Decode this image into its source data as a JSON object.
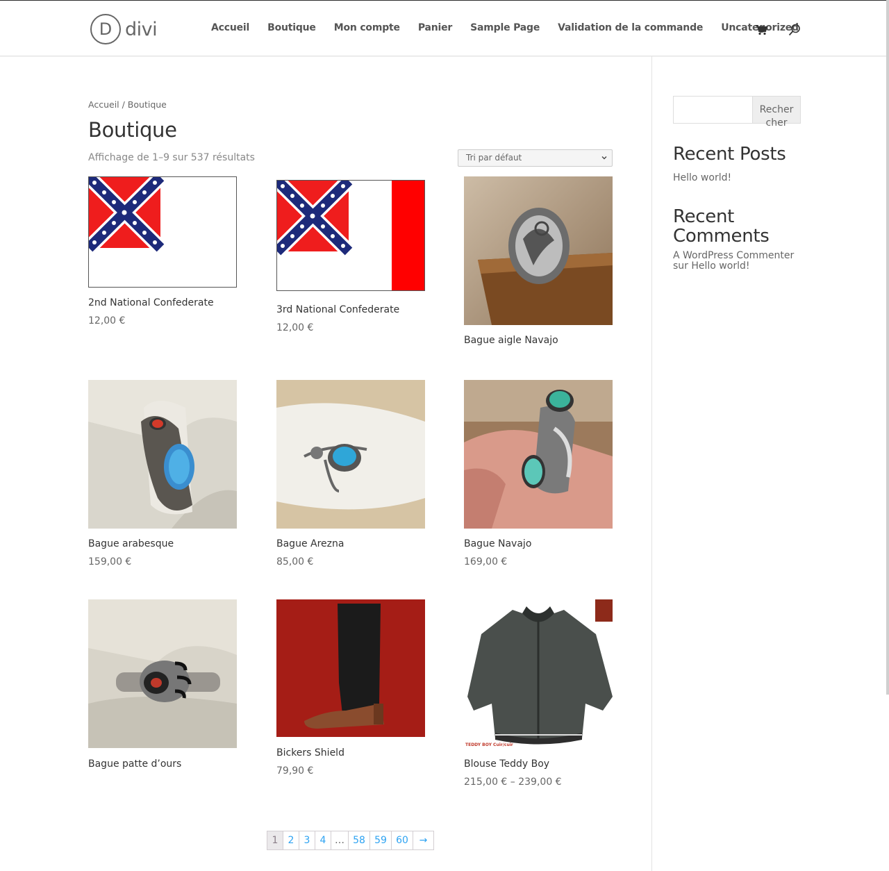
{
  "header": {
    "logo_letter": "D",
    "logo_text": "divi",
    "nav": [
      "Accueil",
      "Boutique",
      "Mon compte",
      "Panier",
      "Sample Page",
      "Validation de la commande",
      "Uncategorized"
    ]
  },
  "breadcrumb": "Accueil / Boutique",
  "page_title": "Boutique",
  "result_count": "Affichage de 1–9 sur 537 résultats",
  "ordering": {
    "selected": "Tri par défaut"
  },
  "products": [
    {
      "title": "2nd National Confederate",
      "price": "12,00 €"
    },
    {
      "title": "3rd National Confederate",
      "price": "12,00 €"
    },
    {
      "title": "Bague aigle Navajo",
      "price": ""
    },
    {
      "title": "Bague arabesque",
      "price": "159,00 €"
    },
    {
      "title": "Bague Arezna",
      "price": "85,00 €"
    },
    {
      "title": "Bague Navajo",
      "price": "169,00 €"
    },
    {
      "title": "Bague patte d’ours",
      "price": ""
    },
    {
      "title": "Bickers Shield",
      "price": "79,90 €"
    },
    {
      "title": "Blouse Teddy Boy",
      "price": "215,00 € – 239,00 €",
      "image_caption": "TEDDY BOY Cuir/cuir"
    }
  ],
  "pagination": [
    "1",
    "2",
    "3",
    "4",
    "…",
    "58",
    "59",
    "60",
    "→"
  ],
  "sidebar": {
    "search_button": "Recher cher",
    "recent_posts_title": "Recent Posts",
    "recent_posts": [
      "Hello world!"
    ],
    "recent_comments_title": "Recent Comments",
    "recent_comment_line1": "A WordPress Commenter",
    "recent_comment_line2": "sur Hello world!"
  }
}
